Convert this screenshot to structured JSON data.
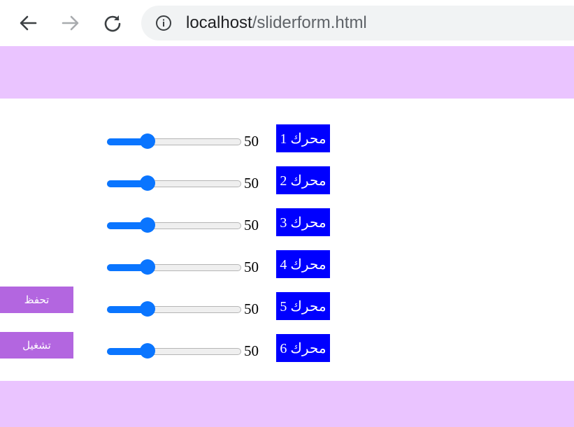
{
  "browser": {
    "url_host": "localhost",
    "url_path": "/sliderform.html"
  },
  "sliders": [
    {
      "value": "50",
      "label": "محرك 1",
      "fraction": 0.3
    },
    {
      "value": "50",
      "label": "محرك 2",
      "fraction": 0.3
    },
    {
      "value": "50",
      "label": "محرك 3",
      "fraction": 0.3
    },
    {
      "value": "50",
      "label": "محرك 4",
      "fraction": 0.3
    },
    {
      "value": "50",
      "label": "محرك 5",
      "fraction": 0.3
    },
    {
      "value": "50",
      "label": "محرك 6",
      "fraction": 0.3
    }
  ],
  "buttons": {
    "save_label": "تحفظ",
    "run_label": "تشغيل"
  },
  "colors": {
    "band": "#eac4ff",
    "motor_label_bg": "#0000ff",
    "side_button_bg": "#b366e0",
    "slider_accent": "#0a75ff"
  }
}
